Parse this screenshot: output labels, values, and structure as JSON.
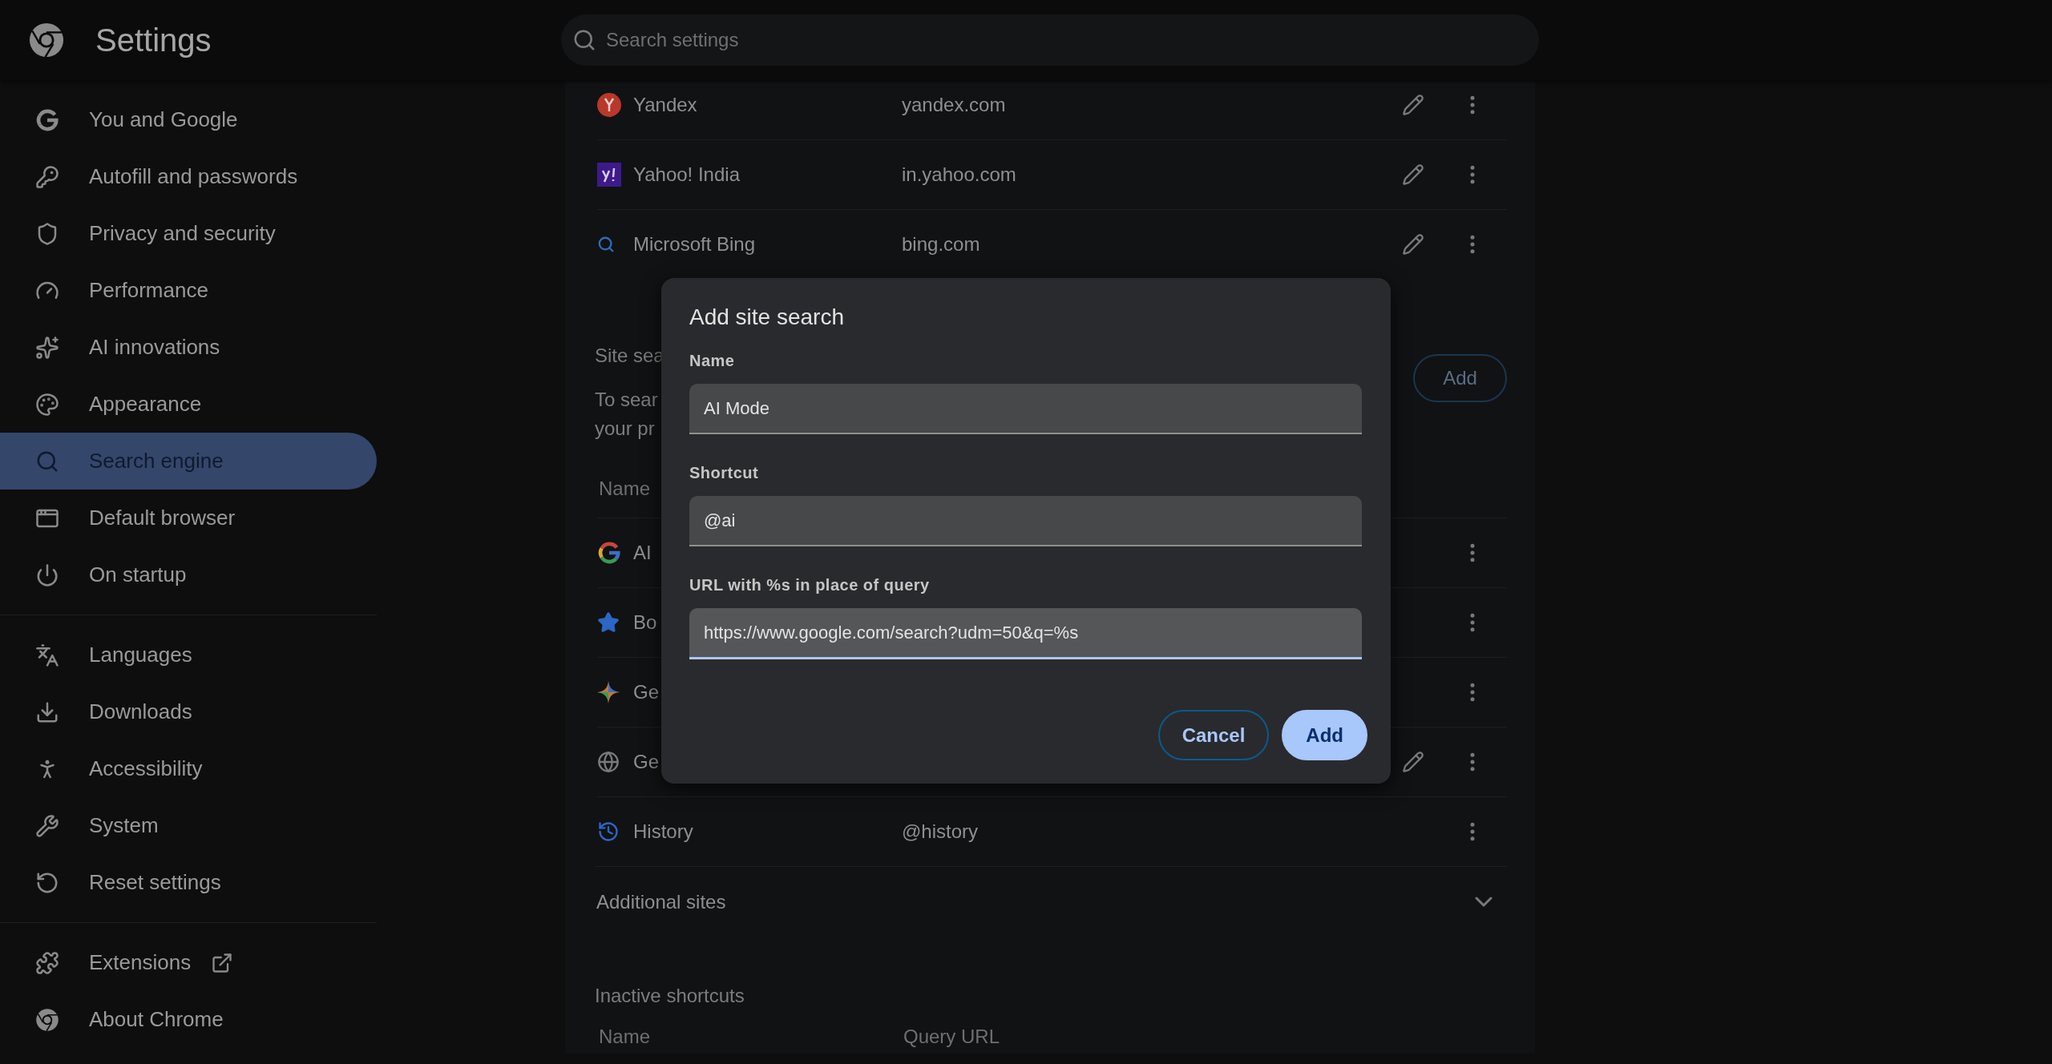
{
  "header": {
    "title": "Settings",
    "search": {
      "placeholder": "Search settings"
    }
  },
  "sidebar": {
    "groups": [
      {
        "items": [
          {
            "label": "You and Google",
            "kind": "google",
            "selected": false
          },
          {
            "label": "Autofill and passwords",
            "kind": "key",
            "selected": false
          },
          {
            "label": "Privacy and security",
            "kind": "shield",
            "selected": false
          },
          {
            "label": "Performance",
            "kind": "gauge",
            "selected": false
          },
          {
            "label": "AI innovations",
            "kind": "sparkles",
            "selected": false
          },
          {
            "label": "Appearance",
            "kind": "palette",
            "selected": false
          },
          {
            "label": "Search engine",
            "kind": "search",
            "selected": true
          },
          {
            "label": "Default browser",
            "kind": "window",
            "selected": false
          },
          {
            "label": "On startup",
            "kind": "power",
            "selected": false
          }
        ]
      },
      {
        "items": [
          {
            "label": "Languages",
            "kind": "languages",
            "selected": false
          },
          {
            "label": "Downloads",
            "kind": "download",
            "selected": false
          },
          {
            "label": "Accessibility",
            "kind": "accessibility",
            "selected": false
          },
          {
            "label": "System",
            "kind": "wrench",
            "selected": false
          },
          {
            "label": "Reset settings",
            "kind": "reset",
            "selected": false
          }
        ]
      },
      {
        "items": [
          {
            "label": "Extensions",
            "kind": "puzzle",
            "selected": false,
            "external": true
          },
          {
            "label": "About Chrome",
            "kind": "chrome",
            "selected": false,
            "external": false
          }
        ]
      }
    ]
  },
  "engines": [
    {
      "name": "Yandex",
      "shortcut": "yandex.com",
      "kind": "yandex",
      "editable": true
    },
    {
      "name": "Yahoo! India",
      "shortcut": "in.yahoo.com",
      "kind": "yahoo",
      "editable": true
    },
    {
      "name": "Microsoft Bing",
      "shortcut": "bing.com",
      "kind": "bing",
      "editable": true
    }
  ],
  "site_search": {
    "title": "Site sea",
    "description": [
      "To sear",
      "your pr"
    ],
    "add_button": "Add",
    "columns": [
      "Name"
    ],
    "rows": [
      {
        "name": "AI",
        "kind": "google",
        "editable": false
      },
      {
        "name": "Bo",
        "kind": "star",
        "editable": false
      },
      {
        "name": "Ge",
        "kind": "gemini",
        "editable": false
      },
      {
        "name": "Ge",
        "kind": "globe",
        "editable": true
      },
      {
        "name": "History",
        "shortcut": "@history",
        "kind": "history",
        "editable": false
      }
    ]
  },
  "additional_sites": {
    "label": "Additional sites",
    "expanded": false
  },
  "inactive": {
    "title": "Inactive shortcuts",
    "columns": [
      "Name",
      "Query URL"
    ]
  },
  "dialog": {
    "title": "Add site search",
    "fields": [
      {
        "label": "Name",
        "value": "AI Mode",
        "focused": false
      },
      {
        "label": "Shortcut",
        "value": "@ai",
        "focused": false
      },
      {
        "label": "URL with %s in place of query",
        "value": "https://www.google.com/search?udm=50&q=%s",
        "focused": true
      }
    ],
    "buttons": [
      {
        "label": "Cancel",
        "kind": "secondary"
      },
      {
        "label": "Add",
        "kind": "primary"
      }
    ]
  }
}
